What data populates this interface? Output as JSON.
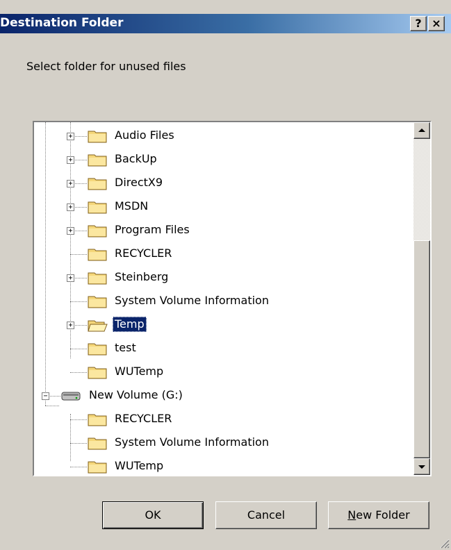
{
  "window": {
    "title": "Destination Folder",
    "help_glyph": "?",
    "close_glyph": "×"
  },
  "prompt": "Select folder for unused files",
  "tree": {
    "items": [
      {
        "label": "Audio Files",
        "expander": "+"
      },
      {
        "label": "BackUp",
        "expander": "+"
      },
      {
        "label": "DirectX9",
        "expander": "+"
      },
      {
        "label": "MSDN",
        "expander": "+"
      },
      {
        "label": "Program Files",
        "expander": "+"
      },
      {
        "label": "RECYCLER",
        "expander": ""
      },
      {
        "label": "Steinberg",
        "expander": "+"
      },
      {
        "label": "System Volume Information",
        "expander": ""
      },
      {
        "label": "Temp",
        "expander": "+",
        "selected": true
      },
      {
        "label": "test",
        "expander": ""
      },
      {
        "label": "WUTemp",
        "expander": ""
      },
      {
        "label": "New Volume (G:)",
        "expander": "−",
        "drive": true
      },
      {
        "label": "RECYCLER",
        "expander": ""
      },
      {
        "label": "System Volume Information",
        "expander": ""
      },
      {
        "label": "WUTemp",
        "expander": ""
      }
    ]
  },
  "buttons": {
    "ok": "OK",
    "cancel": "Cancel",
    "new_folder_first": "N",
    "new_folder_rest": "ew Folder"
  },
  "colors": {
    "face": "#d4d0c8",
    "selection": "#0a246a",
    "title_start": "#0a246a",
    "title_end": "#a6caf0",
    "folder": "#f5d77a"
  }
}
